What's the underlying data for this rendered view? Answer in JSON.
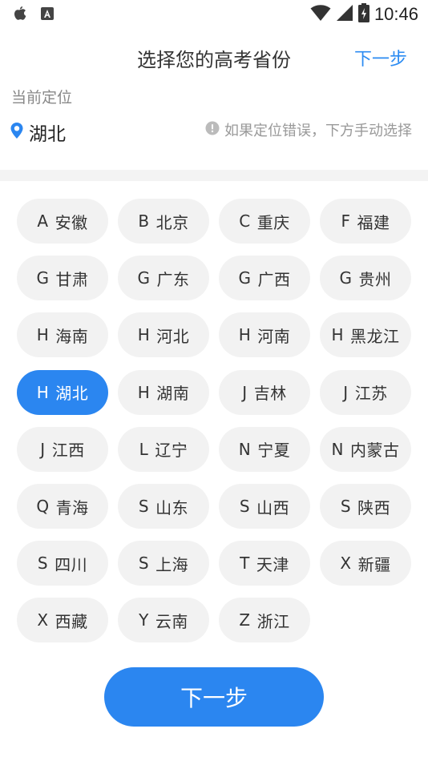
{
  "status_bar": {
    "time": "10:46",
    "left_icons": [
      "apple-icon",
      "a-box-icon"
    ],
    "right_icons": [
      "wifi-icon",
      "signal-icon",
      "battery-charging-icon"
    ]
  },
  "header": {
    "title": "选择您的高考省份",
    "next_label": "下一步"
  },
  "location": {
    "label": "当前定位",
    "city": "湖北",
    "hint": "如果定位错误，下方手动选择"
  },
  "provinces": [
    {
      "letter": "A",
      "name": "安徽"
    },
    {
      "letter": "B",
      "name": "北京"
    },
    {
      "letter": "C",
      "name": "重庆"
    },
    {
      "letter": "F",
      "name": "福建"
    },
    {
      "letter": "G",
      "name": "甘肃"
    },
    {
      "letter": "G",
      "name": "广东"
    },
    {
      "letter": "G",
      "name": "广西"
    },
    {
      "letter": "G",
      "name": "贵州"
    },
    {
      "letter": "H",
      "name": "海南"
    },
    {
      "letter": "H",
      "name": "河北"
    },
    {
      "letter": "H",
      "name": "河南"
    },
    {
      "letter": "H",
      "name": "黑龙江"
    },
    {
      "letter": "H",
      "name": "湖北",
      "selected": true
    },
    {
      "letter": "H",
      "name": "湖南"
    },
    {
      "letter": "J",
      "name": "吉林"
    },
    {
      "letter": "J",
      "name": "江苏"
    },
    {
      "letter": "J",
      "name": "江西"
    },
    {
      "letter": "L",
      "name": "辽宁"
    },
    {
      "letter": "N",
      "name": "宁夏"
    },
    {
      "letter": "N",
      "name": "内蒙古"
    },
    {
      "letter": "Q",
      "name": "青海"
    },
    {
      "letter": "S",
      "name": "山东"
    },
    {
      "letter": "S",
      "name": "山西"
    },
    {
      "letter": "S",
      "name": "陕西"
    },
    {
      "letter": "S",
      "name": "四川"
    },
    {
      "letter": "S",
      "name": "上海"
    },
    {
      "letter": "T",
      "name": "天津"
    },
    {
      "letter": "X",
      "name": "新疆"
    },
    {
      "letter": "X",
      "name": "西藏"
    },
    {
      "letter": "Y",
      "name": "云南"
    },
    {
      "letter": "Z",
      "name": "浙江"
    }
  ],
  "bottom_button": {
    "label": "下一步"
  },
  "colors": {
    "accent": "#2b86f0",
    "chip_bg": "#f2f2f2"
  }
}
